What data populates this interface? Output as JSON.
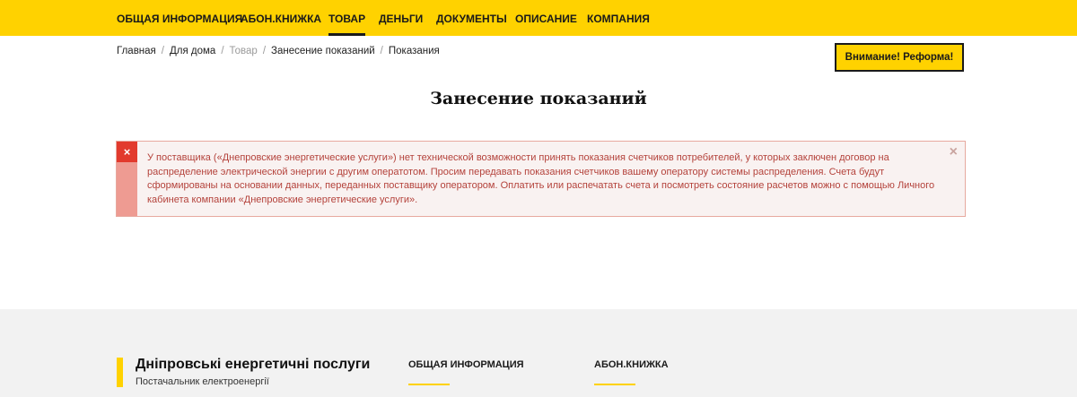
{
  "nav": {
    "items": [
      {
        "label": "Общая информация",
        "active": false
      },
      {
        "label": "Абон.книжка",
        "active": false
      },
      {
        "label": "Товар",
        "active": true
      },
      {
        "label": "Деньги",
        "active": false
      },
      {
        "label": "Документы",
        "active": false
      },
      {
        "label": "Описание",
        "active": false
      },
      {
        "label": "Компания",
        "active": false
      }
    ]
  },
  "breadcrumb": {
    "items": [
      "Главная",
      "Для дома",
      "Товар",
      "Занесение показаний",
      "Показания"
    ],
    "separator": "/"
  },
  "reform_button": {
    "label": "Внимание! Реформа!"
  },
  "page_title": "Занесение показаний",
  "alert": {
    "icon": "close-icon",
    "text": "У поставщика («Днепровские энергетические услуги») нет технической возможности принять показания счетчиков потребителей, у которых заключен договор на распределение электрической энергии с другим оператотом. Просим передавать показания счетчиков вашему оператору системы распределения. Счета будут сформированы на основании данных, переданных поставщику оператором. Оплатить или распечатать счета и посмотреть состояние расчетов можно с помощью Личного кабинета компании «Днепровские энергетические услуги».",
    "close_symbol": "×",
    "mark_symbol": "×"
  },
  "footer": {
    "brand": {
      "name": "Дніпровські енергетичні послуги",
      "subtitle": "Постачальник електроенергії"
    },
    "columns": [
      "Общая информация",
      "Абон.книжка"
    ]
  },
  "colors": {
    "accent": "#ffd200",
    "alert_red": "#e23a2d",
    "alert_text": "#b4423b",
    "footer_bg": "#f2f2f2"
  }
}
